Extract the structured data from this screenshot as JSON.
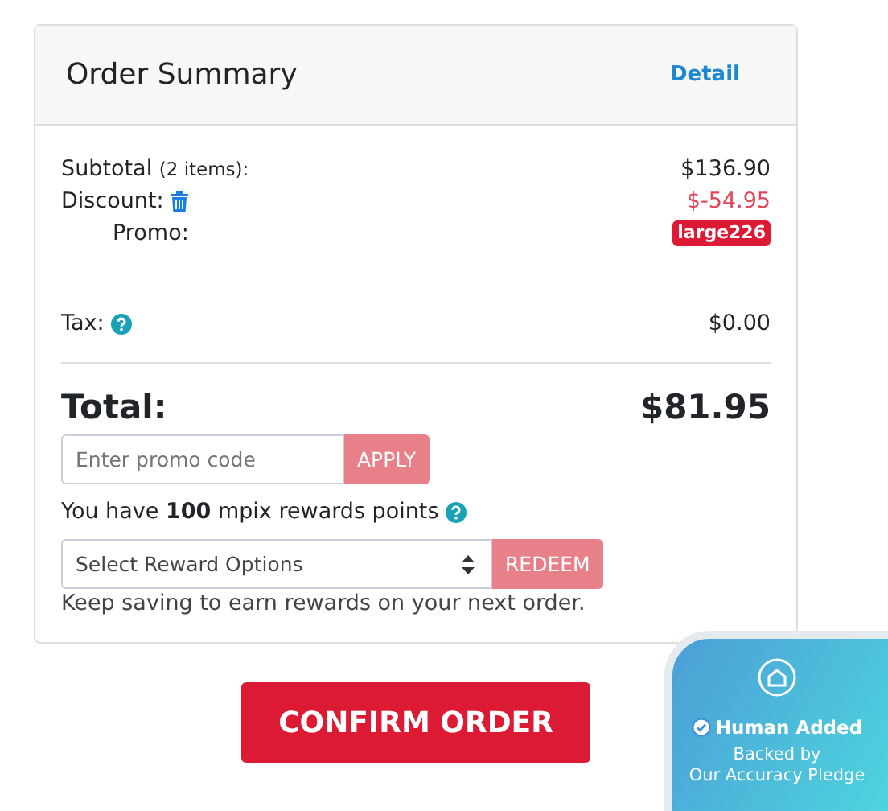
{
  "summary": {
    "title": "Order Summary",
    "detail_link": "Detail",
    "lines": [
      {
        "kind": "subtotal",
        "label": "Subtotal",
        "note": "(2 items):",
        "value": "$136.90"
      },
      {
        "kind": "discount",
        "label": "Discount:",
        "value": "$-54.95"
      },
      {
        "kind": "promo",
        "label": "Promo:",
        "value": "large226"
      },
      {
        "kind": "tax",
        "label": "Tax:",
        "value": "$0.00"
      }
    ],
    "total": {
      "label": "Total:",
      "value": "$81.95"
    },
    "promo_field": {
      "placeholder": "Enter promo code",
      "button": "APPLY"
    },
    "rewards_text": "You have **100** mpix rewards points",
    "reward_select": {
      "value": "Select Reward Options",
      "button": "REDEEM"
    },
    "rewards_note": "Keep saving to earn rewards on your next order."
  },
  "confirm_button": "CONFIRM ORDER",
  "badge": {
    "title": "Human Added",
    "subtitle": [
      "Backed by",
      "Our Accuracy Pledge"
    ]
  }
}
